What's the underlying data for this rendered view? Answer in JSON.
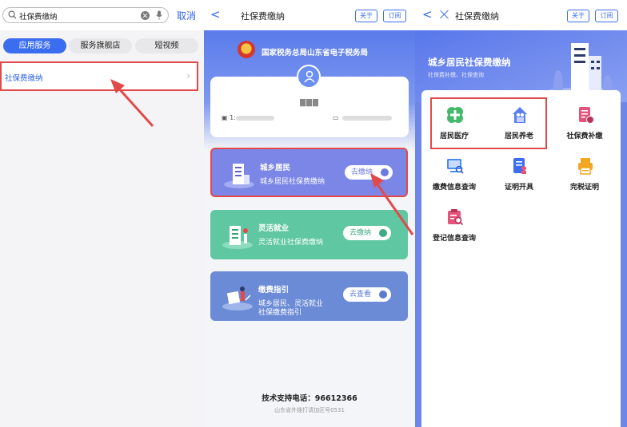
{
  "panel1": {
    "search_query": "社保费缴纳",
    "cancel_label": "取消",
    "tabs": [
      "应用服务",
      "服务旗舰店",
      "短视频"
    ],
    "result_label": "社保费缴纳",
    "chevron": "›"
  },
  "panel2": {
    "back": "<",
    "title": "社保费缴纳",
    "btn_about": "关于",
    "btn_subscribe": "订阅",
    "hero_title": "国家税务总局山东省电子税务局",
    "user_name": "▇▇▇",
    "user_id_prefix": "1:",
    "services": [
      {
        "title": "城乡居民",
        "desc": "城乡居民社保费缴纳",
        "desc2": "",
        "button": "去缴纳",
        "color": "#7b86e6"
      },
      {
        "title": "灵活就业",
        "desc": "灵活就业社保费缴纳",
        "desc2": "",
        "button": "去缴纳",
        "color": "#5fc7a1"
      },
      {
        "title": "缴费指引",
        "desc": "城乡居民、灵活就业",
        "desc2": "社保缴费指引",
        "button": "去查看",
        "color": "#6b8bd6"
      }
    ],
    "footer_phone": "技术支持电话：96612366",
    "footer_note": "山东省外拨打请加区号0531"
  },
  "panel3": {
    "back": "<",
    "title": "社保费缴纳",
    "btn_about": "关于",
    "btn_subscribe": "订阅",
    "hero_title": "城乡居民社保费缴纳",
    "hero_sub": "社保费补缴、社保查询",
    "grid": [
      {
        "label": "居民医疗",
        "icon": "medical-cross-icon",
        "color": "#43b96b"
      },
      {
        "label": "居民养老",
        "icon": "elderly-people-icon",
        "color": "#5b7ff0"
      },
      {
        "label": "社保费补缴",
        "icon": "document-pay-icon",
        "color": "#e5527a"
      },
      {
        "label": "缴费信息查询",
        "icon": "screen-search-icon",
        "color": "#4a8cf0"
      },
      {
        "label": "证明开具",
        "icon": "certificate-icon",
        "color": "#3a6df0"
      },
      {
        "label": "完税证明",
        "icon": "printer-icon",
        "color": "#f2a623"
      },
      {
        "label": "登记信息查询",
        "icon": "registration-search-icon",
        "color": "#e5527a"
      }
    ]
  }
}
